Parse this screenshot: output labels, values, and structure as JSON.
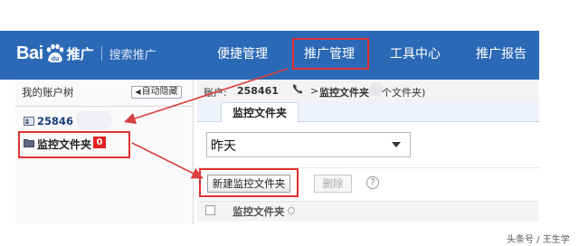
{
  "header": {
    "logo_bai": "Bai",
    "logo_du": "du",
    "logo_tuiguang": "推广",
    "logo_subtitle": "搜索推广",
    "nav": [
      {
        "label": "便捷管理"
      },
      {
        "label": "推广管理"
      },
      {
        "label": "工具中心"
      },
      {
        "label": "推广报告"
      }
    ]
  },
  "sidebar": {
    "title": "我的账户树",
    "auto_hide": "自动隐藏",
    "account_id": "25846",
    "folder_label": "监控文件夹",
    "folder_count": "0"
  },
  "breadcrumb": {
    "label": "账户:",
    "account": "258461",
    "arrow": ">",
    "folder": "监控文件夹",
    "count_text": "个文件夹)"
  },
  "tabs": [
    {
      "label": "监控文件夹"
    }
  ],
  "filter": {
    "selected": "昨天"
  },
  "toolbar": {
    "new_label": "新建监控文件夹",
    "delete_label": "删除",
    "help": "?"
  },
  "table": {
    "columns": [
      "监控文件夹"
    ]
  },
  "watermark": "头条号 / 王生学",
  "colors": {
    "header_bg": "#2b69b6",
    "highlight": "#e03030",
    "badge": "#e52020"
  }
}
